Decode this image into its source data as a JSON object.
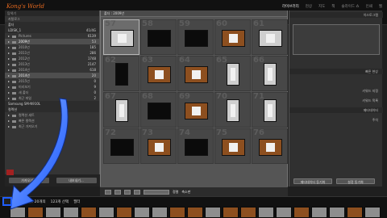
{
  "app": {
    "logo": "Kong's World"
  },
  "modules": [
    "라이브러리",
    "현상",
    "지도",
    "책",
    "슬라이드 쇼",
    "인쇄",
    "웹"
  ],
  "left_panel": {
    "title": "탐색기",
    "catalog": "카탈로그",
    "folders_title": "폴더",
    "rows": [
      {
        "label": "LDISK_1",
        "count": "41/4G",
        "kind": "section"
      },
      {
        "label": "Pictures",
        "count": "6139",
        "kind": "folder"
      },
      {
        "label": "2009년",
        "count": "53",
        "kind": "selected"
      },
      {
        "label": "2010년",
        "count": "185",
        "kind": "folder"
      },
      {
        "label": "2011년",
        "count": "286",
        "kind": "folder"
      },
      {
        "label": "2012년",
        "count": "1748",
        "kind": "folder"
      },
      {
        "label": "2013년",
        "count": "2147",
        "kind": "folder"
      },
      {
        "label": "2014년",
        "count": "618",
        "kind": "folder"
      },
      {
        "label": "2014년 ",
        "count": "20",
        "kind": "selected"
      },
      {
        "label": "2015년",
        "count": "0",
        "kind": "folder"
      },
      {
        "label": "미리보기",
        "count": "9",
        "kind": "folder"
      },
      {
        "label": "새 폴더",
        "count": "0",
        "kind": "folder"
      },
      {
        "label": "최근 파일",
        "count": "2",
        "kind": "folder"
      },
      {
        "label": "Samsung SM-N910L",
        "count": "",
        "kind": "section"
      },
      {
        "label": "컬렉션",
        "count": "",
        "kind": "section"
      },
      {
        "label": "컬렉션 세트",
        "count": "",
        "kind": "folder"
      },
      {
        "label": "빠른 컬렉션",
        "count": "",
        "kind": "folder"
      },
      {
        "label": "최근 가져오기",
        "count": "",
        "kind": "folder"
      }
    ],
    "import_btn": "가져오기...",
    "export_btn": "내보내기..."
  },
  "grid": {
    "header": "폴더 : 2009년",
    "numbers": [
      "57",
      "58",
      "59",
      "60",
      "61",
      "62",
      "63",
      "64",
      "65",
      "66",
      "67",
      "68",
      "69",
      "70",
      "71",
      "72",
      "73",
      "74",
      "75",
      "76"
    ]
  },
  "toolbar": {
    "sort_label": "정렬",
    "thumbnail_label": "축소판"
  },
  "right_panel": {
    "histogram": "히스토그램",
    "quick_develop": "빠른 현상",
    "keywording": "키워드 지정",
    "keyword_list": "키워드 목록",
    "metadata": "메타데이터",
    "comments": "주석",
    "sync_btn": "메타데이터 동기화",
    "settings_btn": "설정 동기화"
  },
  "filmstrip": {
    "folder_text": "폴더 : 2009년 / 20개의",
    "selected_text": "123개 선택",
    "filter_text": "필터"
  }
}
